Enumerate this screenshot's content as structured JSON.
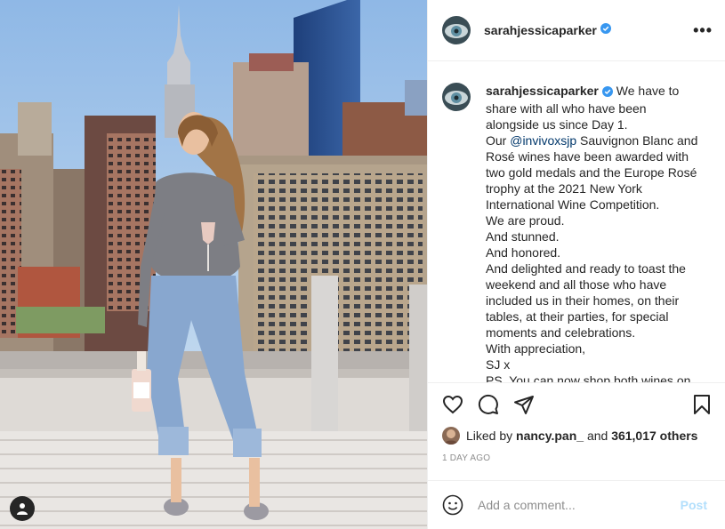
{
  "account": {
    "username": "sarahjessicaparker",
    "verified": true
  },
  "caption_lines": [
    "We have to",
    "share with all who have been",
    "alongside us since Day 1.",
    "Our ",
    "Sauvignon Blanc and",
    "Rosé wines have been awarded with",
    "two gold medals and the Europe Rosé",
    "trophy at the 2021 New York",
    "International Wine Competition.",
    "We are proud.",
    "And stunned.",
    "And honored.",
    "And delighted and ready to toast the",
    "weekend and all those who have",
    "included us in their homes, on their",
    "tables, at their parties, for special",
    "moments and celebrations.",
    "With appreciation,",
    "SJ x",
    "PS. You can now shop both wines on"
  ],
  "mention": "@invivoxsjp",
  "likes": {
    "prefix": "Liked by",
    "user": "nancy.pan_",
    "and": "and",
    "count": "361,017 others"
  },
  "date": "1 DAY AGO",
  "comment": {
    "placeholder": "Add a comment...",
    "post_label": "Post"
  },
  "icons": [
    "verified-badge-icon",
    "more-options-icon",
    "heart-icon",
    "comment-icon",
    "share-icon",
    "bookmark-icon",
    "emoji-icon",
    "user-tag-icon"
  ],
  "colors": {
    "verified": "#3897f0",
    "link": "#00376b",
    "post_disabled": "#b2dffc",
    "muted": "#8e8e8e"
  }
}
